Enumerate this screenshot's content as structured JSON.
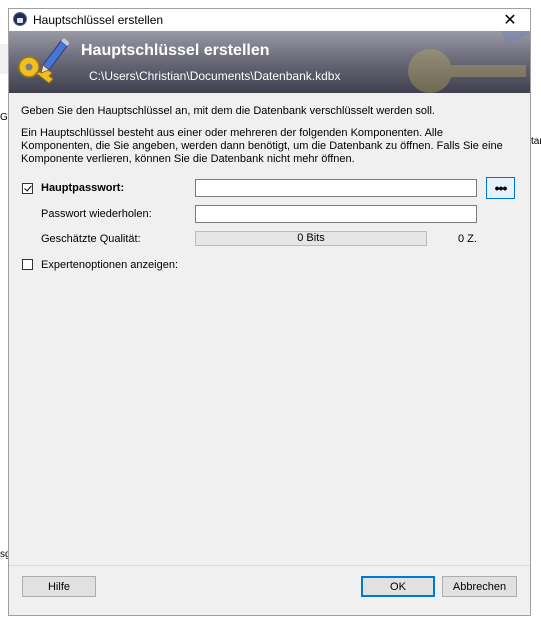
{
  "background_app": {
    "left_fragments": [
      "Ge",
      "sg"
    ],
    "right_fragment": "tar"
  },
  "dialog": {
    "window_title": "Hauptschlüssel erstellen",
    "close_label": "✕",
    "banner": {
      "title": "Hauptschlüssel erstellen",
      "path": "C:\\Users\\Christian\\Documents\\Datenbank.kdbx"
    },
    "intro_text": "Geben Sie den Hauptschlüssel an, mit dem die Datenbank verschlüsselt werden soll.",
    "info_text": "Ein Hauptschlüssel besteht aus einer oder mehreren der folgenden Komponenten. Alle Komponenten, die Sie angeben, werden dann benötigt, um die Datenbank zu öffnen. Falls Sie eine Komponente verlieren, können Sie die Datenbank nicht mehr öffnen.",
    "master_password": {
      "checked": true,
      "label": "Hauptpasswort:",
      "value": "",
      "reveal_button": "•••"
    },
    "repeat_password": {
      "label": "Passwort wiederholen:",
      "value": ""
    },
    "quality": {
      "label": "Geschätzte Qualität:",
      "bar_text": "0 Bits",
      "chars_text": "0 Z.",
      "fill_fraction": 0
    },
    "expert_options": {
      "checked": false,
      "label": "Expertenoptionen anzeigen:"
    },
    "buttons": {
      "help": "Hilfe",
      "ok": "OK",
      "cancel": "Abbrechen"
    }
  },
  "colors": {
    "banner_dark": "#3f3f4e",
    "focus_accent": "#0078d7"
  }
}
